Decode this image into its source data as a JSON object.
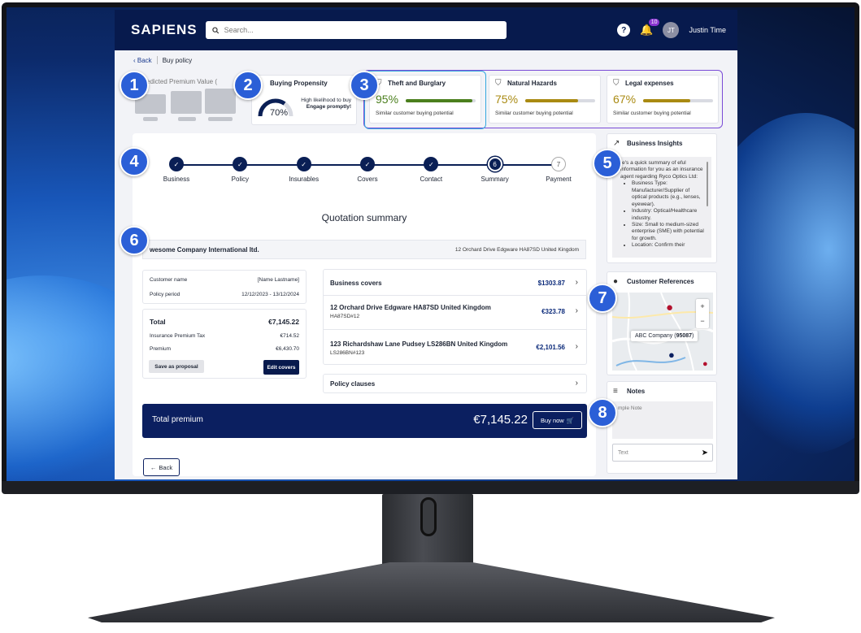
{
  "app": {
    "logo": "SAPIENS",
    "search_placeholder": "Search...",
    "help_icon": "?",
    "notification_count": "10",
    "user_initials": "JT",
    "user_name": "Justin Time"
  },
  "breadcrumb": {
    "back": "Back",
    "current": "Buy policy"
  },
  "premium_card": {
    "title": "Predicted Premium Value ("
  },
  "propensity": {
    "title": "Buying Propensity",
    "value": "70%",
    "value_fraction": 0.7,
    "text": "High likelihood to buy",
    "action": "Engage promptly!"
  },
  "risks": [
    {
      "title": "Theft and Burglary",
      "pct": "95%",
      "fraction": 0.95,
      "color": "#4b7f1d",
      "subtitle": "Similar customer buying potential",
      "icon": "shield-icon"
    },
    {
      "title": "Natural Hazards",
      "pct": "75%",
      "fraction": 0.75,
      "color": "#a98a12",
      "subtitle": "Similar customer buying potential",
      "icon": "shield-icon"
    },
    {
      "title": "Legal expenses",
      "pct": "67%",
      "fraction": 0.67,
      "color": "#a98a12",
      "subtitle": "Similar customer buying potential",
      "icon": "shield-icon"
    }
  ],
  "steps": [
    {
      "label": "Business",
      "state": "done",
      "num": ""
    },
    {
      "label": "Policy",
      "state": "done",
      "num": ""
    },
    {
      "label": "Insurables",
      "state": "done",
      "num": ""
    },
    {
      "label": "Covers",
      "state": "done",
      "num": ""
    },
    {
      "label": "Contact",
      "state": "done",
      "num": ""
    },
    {
      "label": "Summary",
      "state": "current",
      "num": "6"
    },
    {
      "label": "Payment",
      "state": "pending",
      "num": "7"
    }
  ],
  "quote": {
    "title": "Quotation summary",
    "company": "wesome Company International ltd.",
    "address": "12 Orchard Drive Edgware HA87SD United Kingdom",
    "customer_name_label": "Customer name",
    "customer_name_value": "[Name Lastname]",
    "policy_period_label": "Policy period",
    "policy_period_value": "12/12/2023 - 13/12/2024",
    "total_label": "Total",
    "total_value": "€7,145.22",
    "ipt_label": "Insurance Premium Tax",
    "ipt_value": "€714.52",
    "premium_label": "Premium",
    "premium_value": "€6,430.70",
    "save_label": "Save as proposal",
    "edit_label": "Edit covers"
  },
  "covers": {
    "business_label": "Business covers",
    "business_amount": "$1303.87",
    "items": [
      {
        "title": "12 Orchard Drive Edgware HA87SD United Kingdom",
        "ref": "HA87SD#12",
        "amount": "€323.78"
      },
      {
        "title": "123 Richardshaw Lane Pudsey LS286BN United Kingdom",
        "ref": "LS286BN#123",
        "amount": "€2,101.56"
      }
    ],
    "clauses_label": "Policy clauses"
  },
  "total_premium": {
    "label": "Total premium",
    "amount": "€7,145.22",
    "buy_label": "Buy now"
  },
  "back_button": "Back",
  "insights": {
    "title": "Business Insights",
    "intro": "re's a quick summary of eful information for you as an insurance agent regarding Ryco Optics Ltd:",
    "bullets": [
      "Business Type: Manufacturer/Supplier of optical products (e.g., lenses, eyewear).",
      "Industry: Optical/Healthcare industry.",
      "Size: Small to medium-sized enterprise (SME) with potential for growth.",
      "Location: Confirm their"
    ]
  },
  "references": {
    "title": "Customer References",
    "tooltip_name": "ABC Company",
    "tooltip_id": "95087"
  },
  "notes": {
    "title": "Notes",
    "sample": "mple Note",
    "input_placeholder": "Text"
  },
  "badges": [
    "1",
    "2",
    "3",
    "4",
    "5",
    "6",
    "7",
    "8"
  ]
}
